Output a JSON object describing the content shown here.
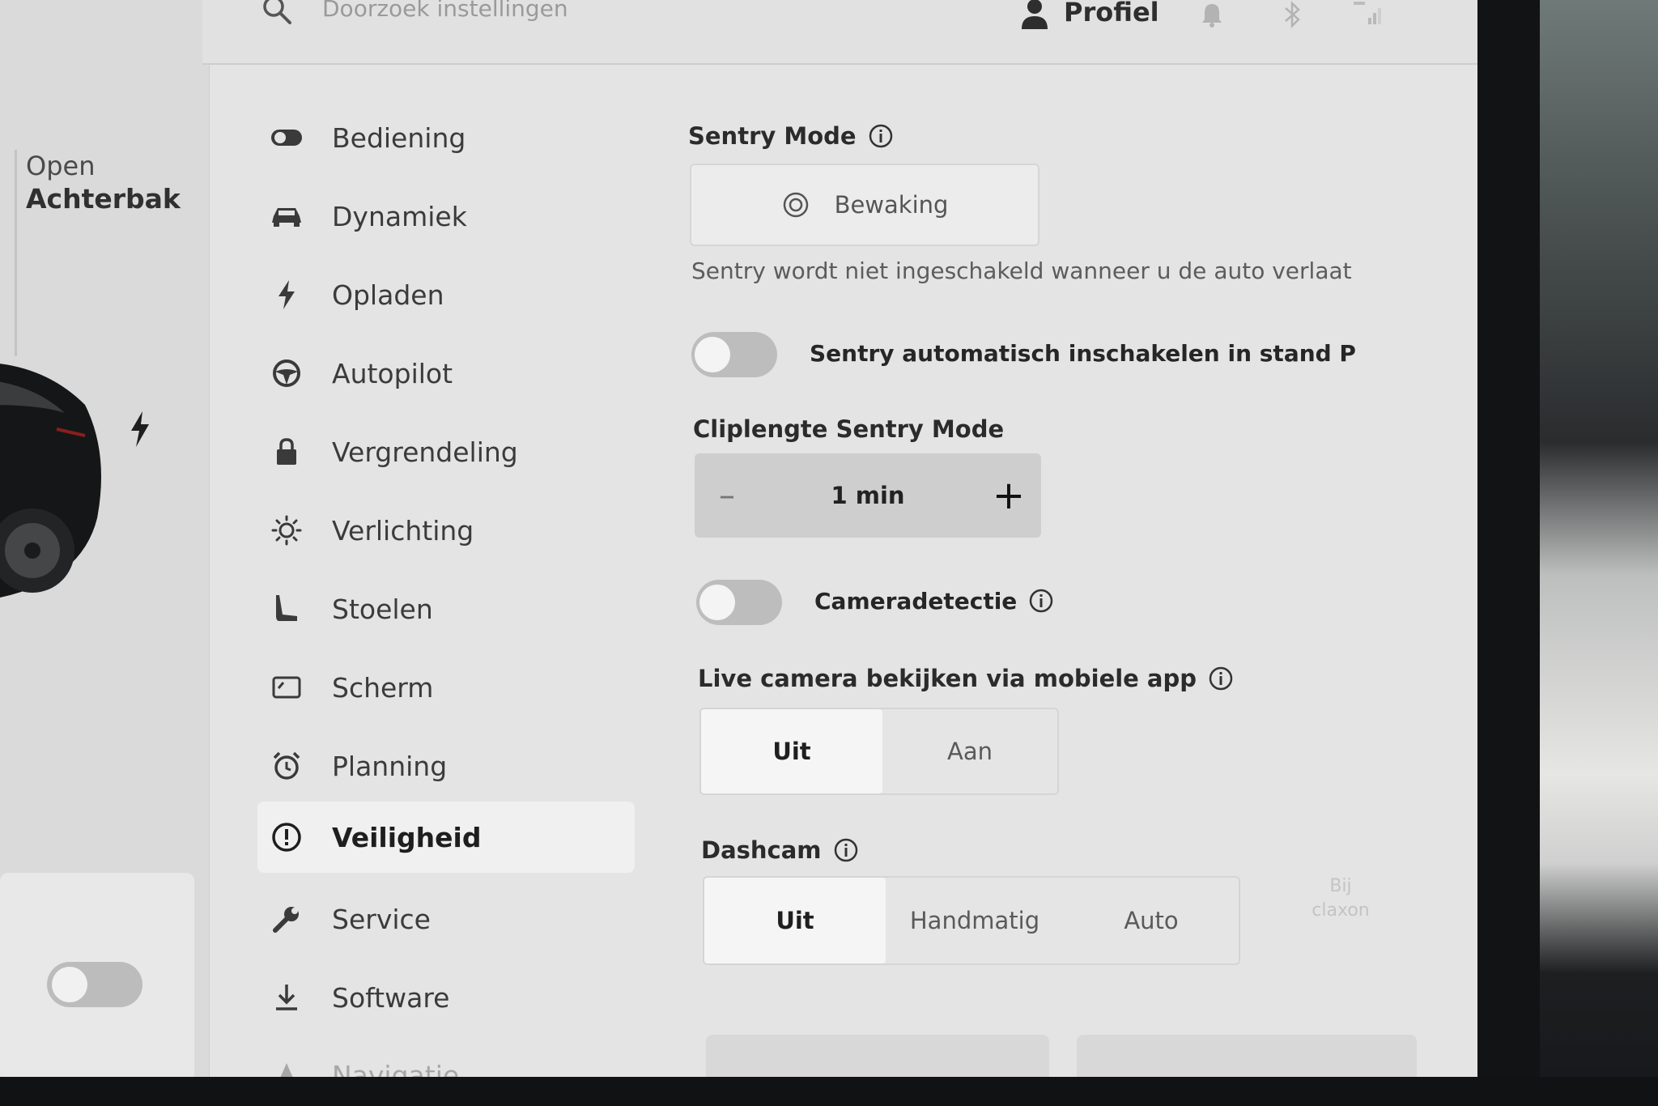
{
  "search": {
    "placeholder": "Doorzoek instellingen"
  },
  "header": {
    "profile_label": "Profiel"
  },
  "car_panel": {
    "trunk_open": "Open",
    "trunk_label": "Achterbak",
    "card_toggle_on": false
  },
  "sidebar": {
    "items": [
      {
        "label": "Bediening",
        "icon": "toggle-icon"
      },
      {
        "label": "Dynamiek",
        "icon": "car-icon"
      },
      {
        "label": "Opladen",
        "icon": "lightning-icon"
      },
      {
        "label": "Autopilot",
        "icon": "steering-wheel-icon"
      },
      {
        "label": "Vergrendeling",
        "icon": "lock-icon"
      },
      {
        "label": "Verlichting",
        "icon": "sun-icon"
      },
      {
        "label": "Stoelen",
        "icon": "seat-icon"
      },
      {
        "label": "Scherm",
        "icon": "display-icon"
      },
      {
        "label": "Planning",
        "icon": "alarm-clock-icon"
      },
      {
        "label": "Veiligheid",
        "icon": "alert-circle-icon",
        "active": true
      },
      {
        "label": "Service",
        "icon": "wrench-icon"
      },
      {
        "label": "Software",
        "icon": "download-icon"
      },
      {
        "label": "Navigatie",
        "icon": "navigation-icon"
      }
    ]
  },
  "content": {
    "sentry": {
      "title": "Sentry Mode",
      "button_label": "Bewaking",
      "note": "Sentry wordt niet ingeschakeld wanneer u de auto verlaat",
      "auto_toggle_label": "Sentry automatisch inschakelen in stand P",
      "auto_toggle_on": false
    },
    "clip": {
      "title": "Cliplengte Sentry Mode",
      "value": "1 min",
      "minus": "–",
      "plus": "+"
    },
    "camera_detection": {
      "label": "Cameradetectie",
      "on": false
    },
    "live_camera": {
      "title": "Live camera bekijken via mobiele app",
      "options": [
        "Uit",
        "Aan"
      ],
      "selected": "Uit"
    },
    "dashcam": {
      "title": "Dashcam",
      "options": [
        "Uit",
        "Handmatig",
        "Auto"
      ],
      "selected": "Uit",
      "extra_option_line1": "Bij",
      "extra_option_line2": "claxon"
    }
  }
}
